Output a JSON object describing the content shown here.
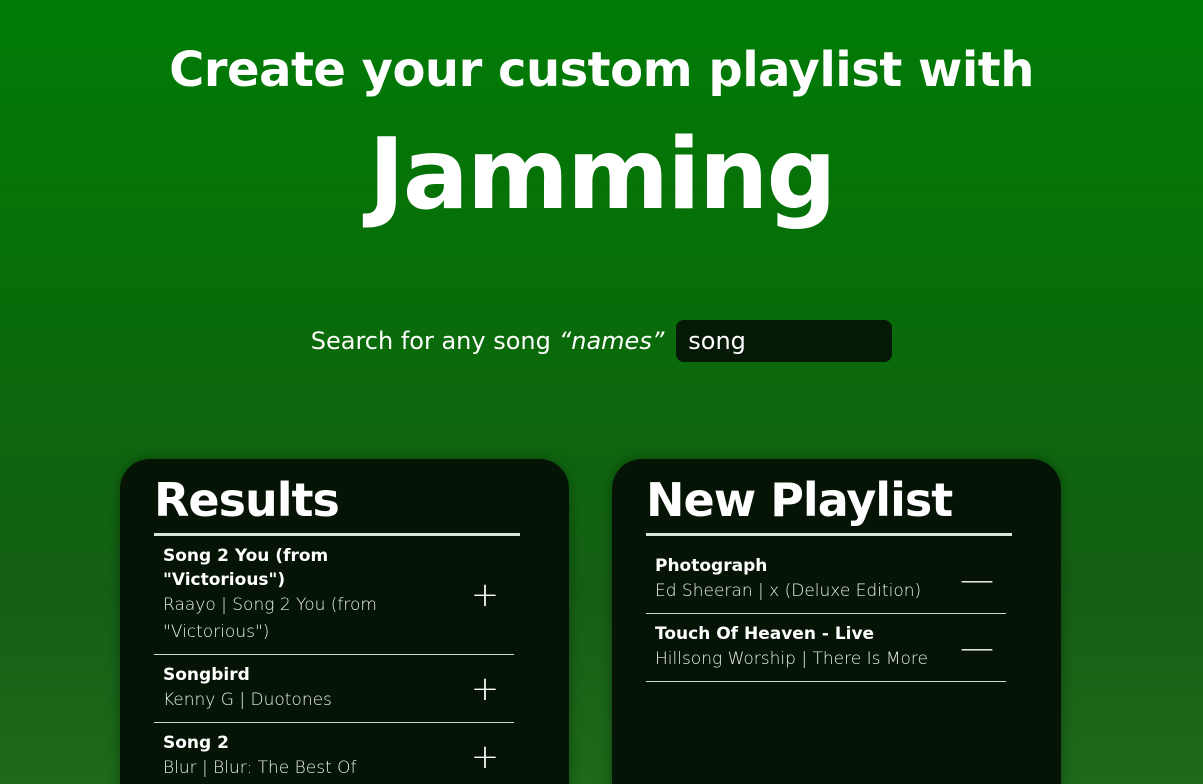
{
  "header": {
    "subtitle": "Create your custom playlist with",
    "title": "Jamming"
  },
  "search": {
    "label_prefix": "Search for any song",
    "label_emphasis": "“names”",
    "value": "song",
    "placeholder": ""
  },
  "results": {
    "title": "Results",
    "tracks": [
      {
        "name": "Song 2 You (from \"Victorious\")",
        "meta": "Raayo | Song 2 You (from \"Victorious\")",
        "action": "+"
      },
      {
        "name": "Songbird",
        "meta": "Kenny G | Duotones",
        "action": "+"
      },
      {
        "name": "Song 2",
        "meta": "Blur | Blur: The Best Of",
        "action": "+"
      }
    ]
  },
  "playlist": {
    "title": "New Playlist",
    "tracks": [
      {
        "name": "Photograph",
        "meta": "Ed Sheeran | x (Deluxe Edition)",
        "action": "—"
      },
      {
        "name": "Touch Of Heaven - Live",
        "meta": "Hillsong Worship | There Is More",
        "action": "—"
      }
    ]
  },
  "colors": {
    "background_top": "#007c05",
    "background_bottom": "#1d6a1a",
    "panel": "#051405",
    "input": "#061906"
  }
}
